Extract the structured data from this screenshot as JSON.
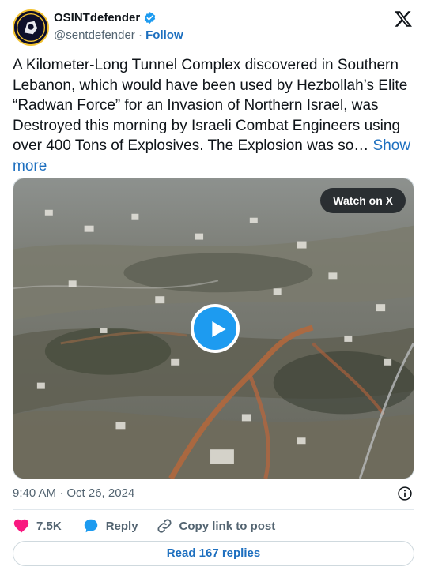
{
  "header": {
    "display_name": "OSINTdefender",
    "handle": "@sentdefender",
    "separator": "·",
    "follow_label": "Follow"
  },
  "tweet": {
    "text": "A Kilometer-Long Tunnel Complex discovered in Southern Lebanon, which would have been used by Hezbollah’s Elite “Radwan Force” for an Invasion of Northern Israel, was Destroyed this morning by Israeli Combat Engineers using over 400 Tons of Explosives. The Explosion was so…",
    "show_more_label": "Show more"
  },
  "media": {
    "watch_label": "Watch on X"
  },
  "meta": {
    "timestamp": "9:40 AM · Oct 26, 2024"
  },
  "actions": {
    "likes_count": "7.5K",
    "reply_label": "Reply",
    "copy_link_label": "Copy link to post"
  },
  "footer": {
    "read_replies_label": "Read 167 replies"
  },
  "colors": {
    "accent_blue": "#1d9bf0",
    "link_blue": "#1d6fbf",
    "like_pink": "#f91880",
    "verified_blue": "#1d9bf0"
  },
  "icons": [
    "avatar-logo",
    "verified-badge-icon",
    "x-logo-icon",
    "play-icon",
    "info-icon",
    "heart-icon",
    "reply-bubble-icon",
    "link-icon"
  ]
}
